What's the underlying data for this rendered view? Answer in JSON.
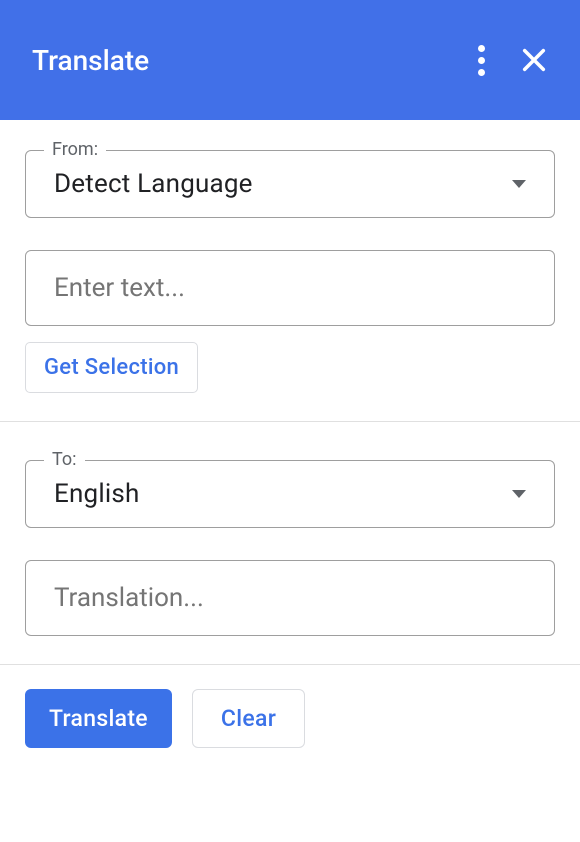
{
  "header": {
    "title": "Translate"
  },
  "from": {
    "label": "From:",
    "value": "Detect Language",
    "placeholder": "Enter text...",
    "get_selection": "Get Selection"
  },
  "to": {
    "label": "To:",
    "value": "English",
    "placeholder": "Translation..."
  },
  "actions": {
    "translate": "Translate",
    "clear": "Clear"
  }
}
